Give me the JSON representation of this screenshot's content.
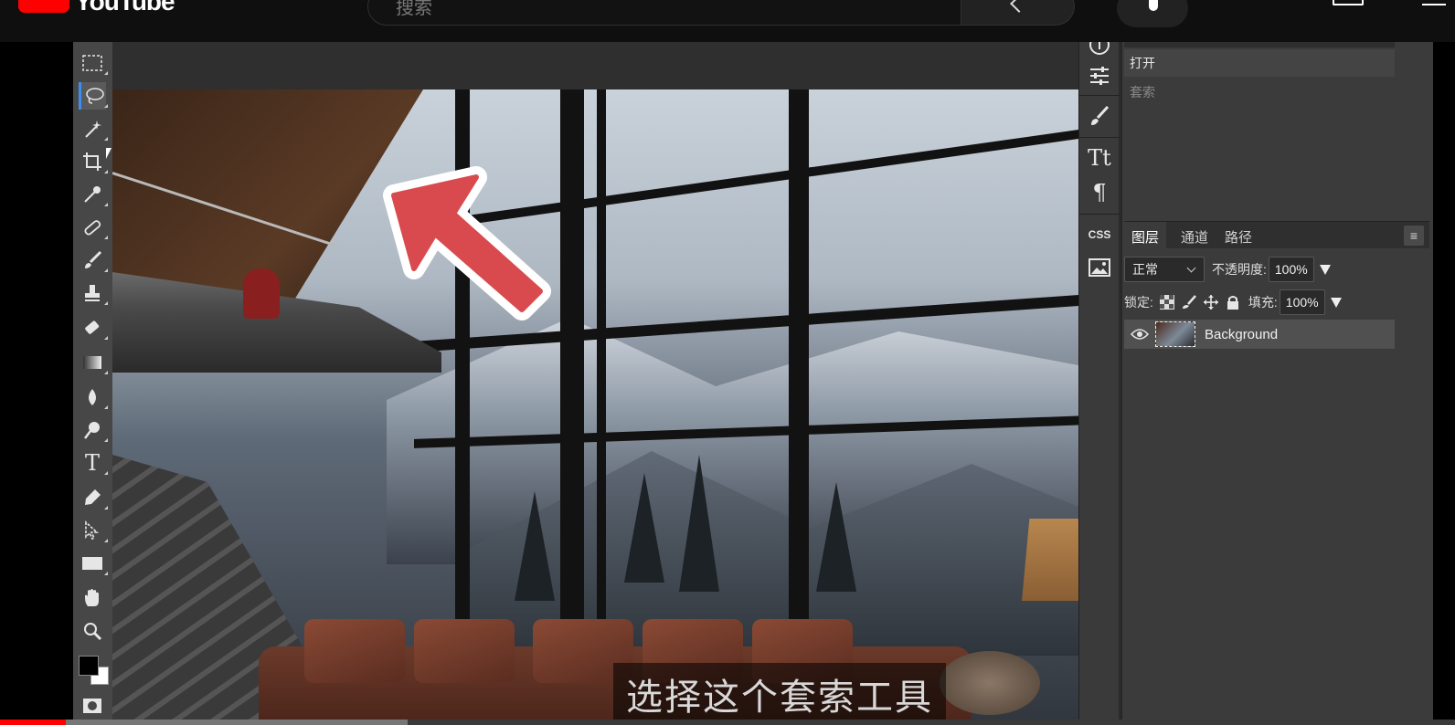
{
  "youtube": {
    "wordmark": "YouTube",
    "search_placeholder": "搜索"
  },
  "editor": {
    "history": {
      "items": [
        "打开",
        "套索"
      ]
    },
    "layers_panel": {
      "tabs": [
        "图层",
        "通道",
        "路径"
      ],
      "menu_glyph": "≡",
      "blend_mode": "正常",
      "opacity_label": "不透明度:",
      "opacity_value": "100%",
      "lock_label": "锁定:",
      "fill_label": "填充:",
      "fill_value": "100%",
      "layers": [
        {
          "name": "Background",
          "visible": true
        }
      ]
    },
    "icon_column": {
      "css_label": "CSS"
    },
    "active_tool": "lasso-tool"
  },
  "video": {
    "subtitle": "选择这个套索工具",
    "progress_played_fraction": 0.045,
    "progress_buffered_fraction": 0.28
  },
  "colors": {
    "youtube_red": "#ff0000",
    "active_tool_accent": "#3c8ff0",
    "annotation_arrow": "#d94a4f"
  }
}
